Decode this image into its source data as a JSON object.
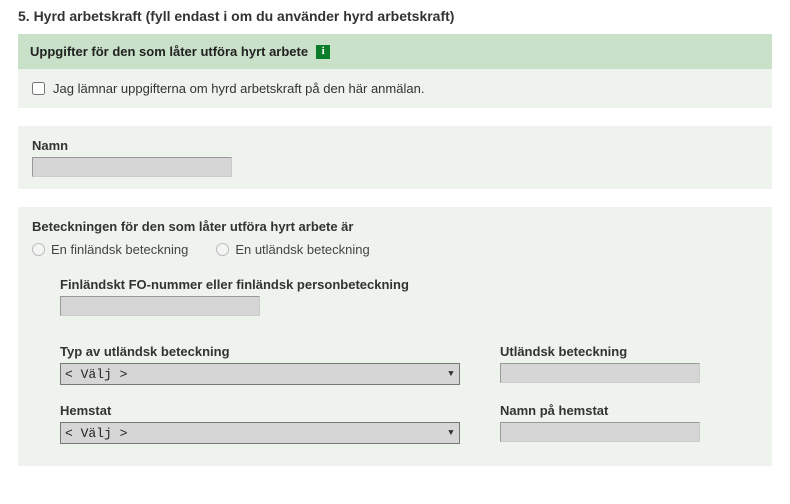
{
  "section": {
    "title": "5. Hyrd arbetskraft (fyll endast i om du använder hyrd arbetskraft)"
  },
  "header": {
    "title": "Uppgifter för den som låter utföra hyrt arbete",
    "info_glyph": "i"
  },
  "checkbox": {
    "label": "Jag lämnar uppgifterna om hyrd arbetskraft på den här anmälan."
  },
  "name_field": {
    "label": "Namn",
    "value": ""
  },
  "id_group": {
    "legend": "Beteckningen för den som låter utföra hyrt arbete är",
    "option_fi": "En finländsk beteckning",
    "option_fo": "En utländsk beteckning"
  },
  "fi_id": {
    "label": "Finländskt FO-nummer eller finländsk personbeteckning",
    "value": ""
  },
  "foreign_type": {
    "label": "Typ av utländsk beteckning",
    "selected": "< Välj >"
  },
  "foreign_id": {
    "label": "Utländsk beteckning",
    "value": ""
  },
  "home_state": {
    "label": "Hemstat",
    "selected": "< Välj >"
  },
  "home_state_name": {
    "label": "Namn på hemstat",
    "value": ""
  }
}
